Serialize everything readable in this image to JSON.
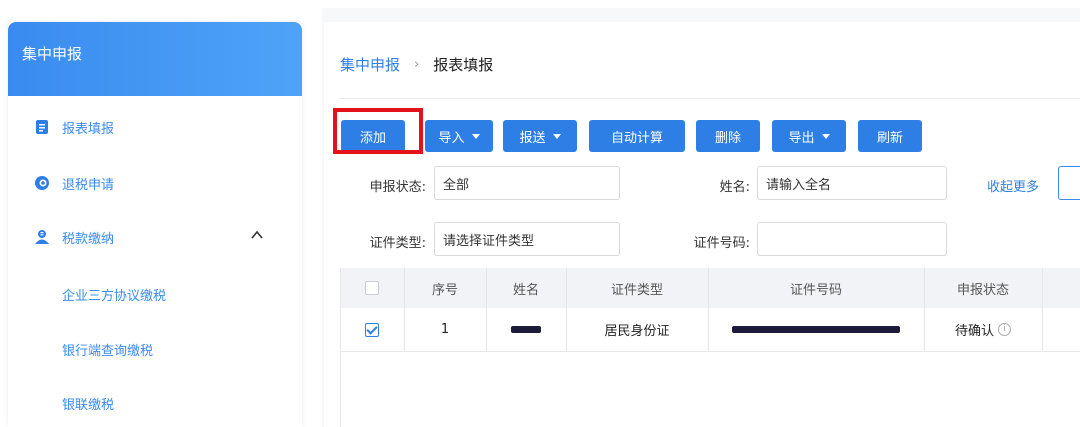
{
  "sidebar": {
    "title": "集中申报",
    "items": [
      {
        "label": "报表填报",
        "icon": "document-icon"
      },
      {
        "label": "退税申请",
        "icon": "refund-icon"
      },
      {
        "label": "税款缴纳",
        "icon": "user-pay-icon",
        "expanded": true
      },
      {
        "label": "企业三方协议缴税"
      },
      {
        "label": "银行端查询缴税"
      },
      {
        "label": "银联缴税"
      }
    ]
  },
  "breadcrumb": {
    "parent": "集中申报",
    "separator": "›",
    "current": "报表填报"
  },
  "toolbar": {
    "add": "添加",
    "import": "导入",
    "submit": "报送",
    "auto_calc": "自动计算",
    "delete": "删除",
    "export": "导出",
    "refresh": "刷新"
  },
  "filters": {
    "status_label": "申报状态:",
    "status_value": "全部",
    "name_label": "姓名:",
    "name_placeholder": "请输入全名",
    "collapse_link": "收起更多",
    "id_type_label": "证件类型:",
    "id_type_placeholder": "请选择证件类型",
    "id_number_label": "证件号码:",
    "id_number_value": ""
  },
  "table": {
    "columns": [
      "序号",
      "姓名",
      "证件类型",
      "证件号码",
      "申报状态"
    ],
    "rows": [
      {
        "checked": true,
        "index": "1",
        "name": "[redacted]",
        "id_type": "居民身份证",
        "id_number": "[redacted]",
        "status": "待确认"
      }
    ]
  },
  "colors": {
    "primary": "#2d7fe6",
    "highlight": "#e4131b",
    "sidebar_header": "#3a8bf0"
  }
}
